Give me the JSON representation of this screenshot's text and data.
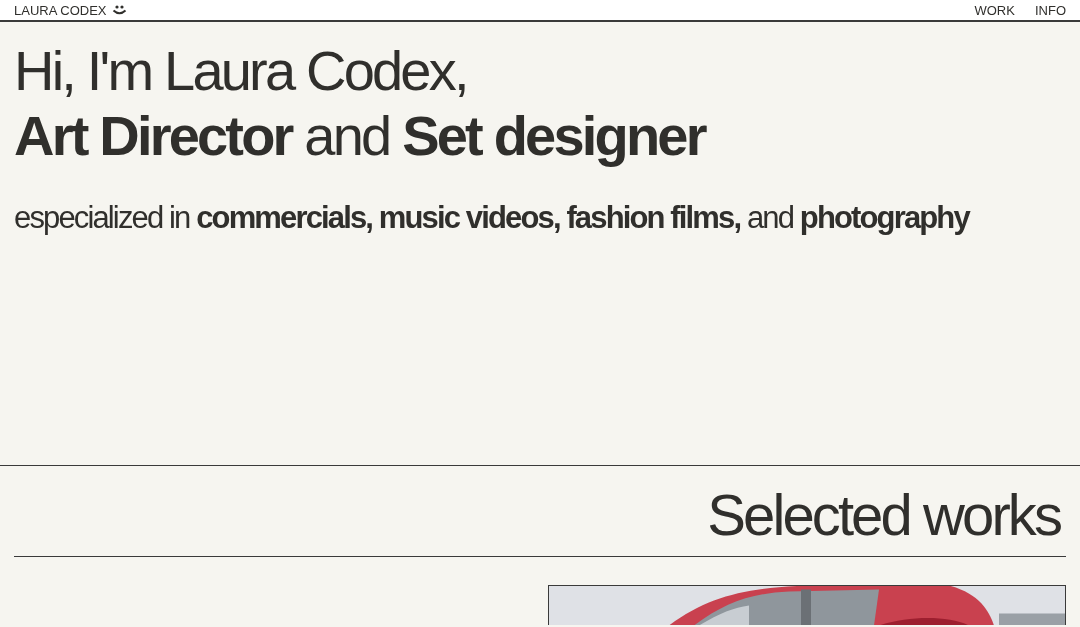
{
  "header": {
    "brand": "LAURA CODEX",
    "nav": [
      {
        "label": "WORK"
      },
      {
        "label": "INFO"
      }
    ]
  },
  "hero": {
    "greeting": "Hi, I'm Laura Codex,",
    "roles": "**Art Director** and **Set designer**",
    "specialties": "especialized in **commercials, music videos, fashion films,** and **photography**"
  },
  "works": {
    "title": "Selected works"
  }
}
